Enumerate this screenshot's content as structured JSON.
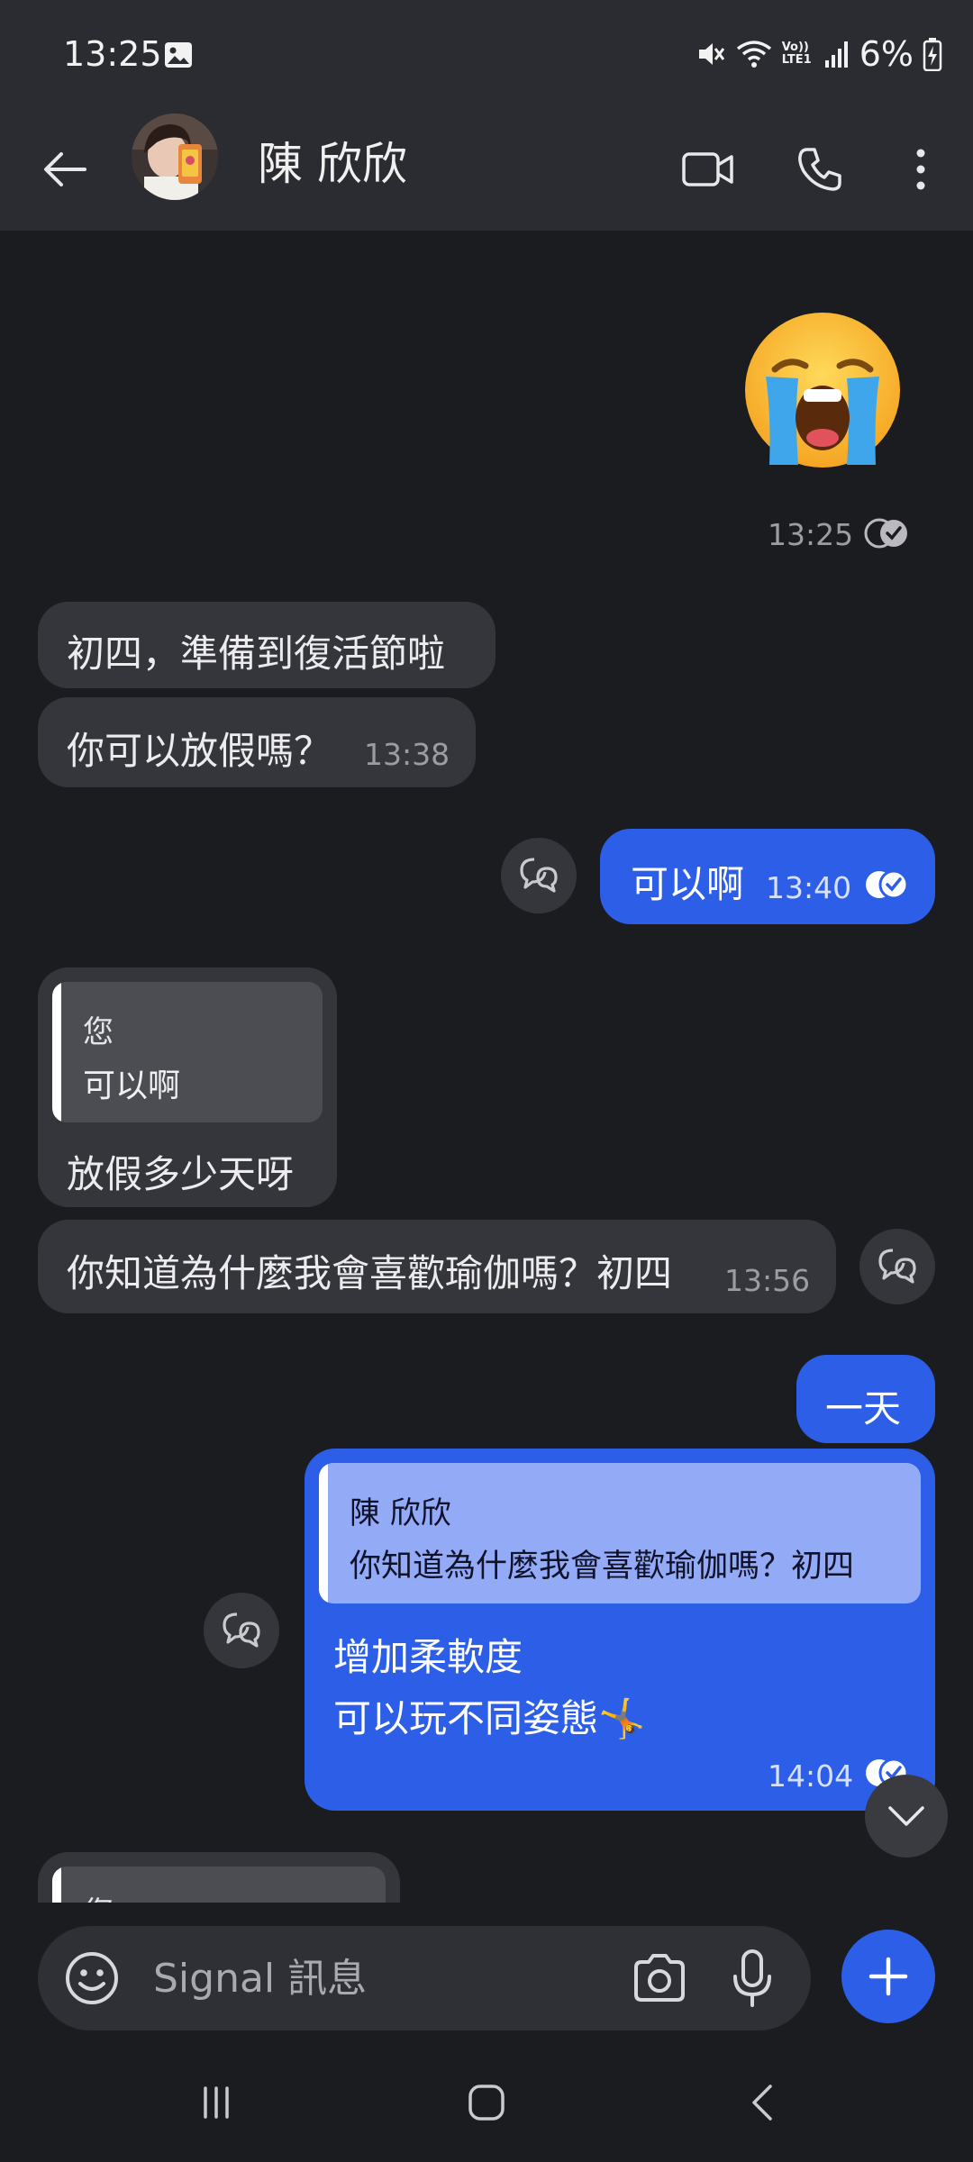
{
  "status_bar": {
    "time": "13:25",
    "battery_percent": "6%",
    "network_label": "Vo)) LTE1"
  },
  "header": {
    "contact_name": "陳 欣欣",
    "icons": [
      "back-arrow-icon",
      "video-call-icon",
      "phone-call-icon",
      "more-options-icon"
    ]
  },
  "conversation": {
    "messages": [
      {
        "id": "m1",
        "direction": "outgoing",
        "type": "emoji",
        "emoji": "😭",
        "time": "13:25",
        "status": "delivered"
      },
      {
        "id": "m2",
        "direction": "incoming",
        "text": "初四，準備到復活節啦"
      },
      {
        "id": "m3",
        "direction": "incoming",
        "text": "你可以放假嗎？",
        "time": "13:38"
      },
      {
        "id": "m4",
        "direction": "outgoing",
        "text": "可以啊",
        "time": "13:40",
        "status": "read"
      },
      {
        "id": "m5",
        "direction": "incoming",
        "quote": {
          "author": "您",
          "text": "可以啊"
        },
        "text": "放假多少天呀"
      },
      {
        "id": "m6",
        "direction": "incoming",
        "text": "你知道為什麼我會喜歡瑜伽嗎？初四",
        "time": "13:56"
      },
      {
        "id": "m7",
        "direction": "outgoing",
        "text": "一天"
      },
      {
        "id": "m8",
        "direction": "outgoing",
        "quote": {
          "author": "陳 欣欣",
          "text": "你知道為什麼我會喜歡瑜伽嗎？初四"
        },
        "lines": [
          "增加柔軟度",
          "可以玩不同姿態🤸"
        ],
        "time": "14:04",
        "status": "read"
      },
      {
        "id": "m9",
        "direction": "incoming",
        "quote": {
          "author": "您",
          "text": ""
        },
        "partial": true
      }
    ]
  },
  "composer": {
    "placeholder": "Signal 訊息"
  },
  "colors": {
    "background": "#1b1c1f",
    "header": "#2b2c31",
    "incoming_bubble": "#35363b",
    "outgoing_bubble": "#2c5ee8",
    "outgoing_quote": "#93aaf6",
    "incoming_quote": "#4c4d52"
  }
}
